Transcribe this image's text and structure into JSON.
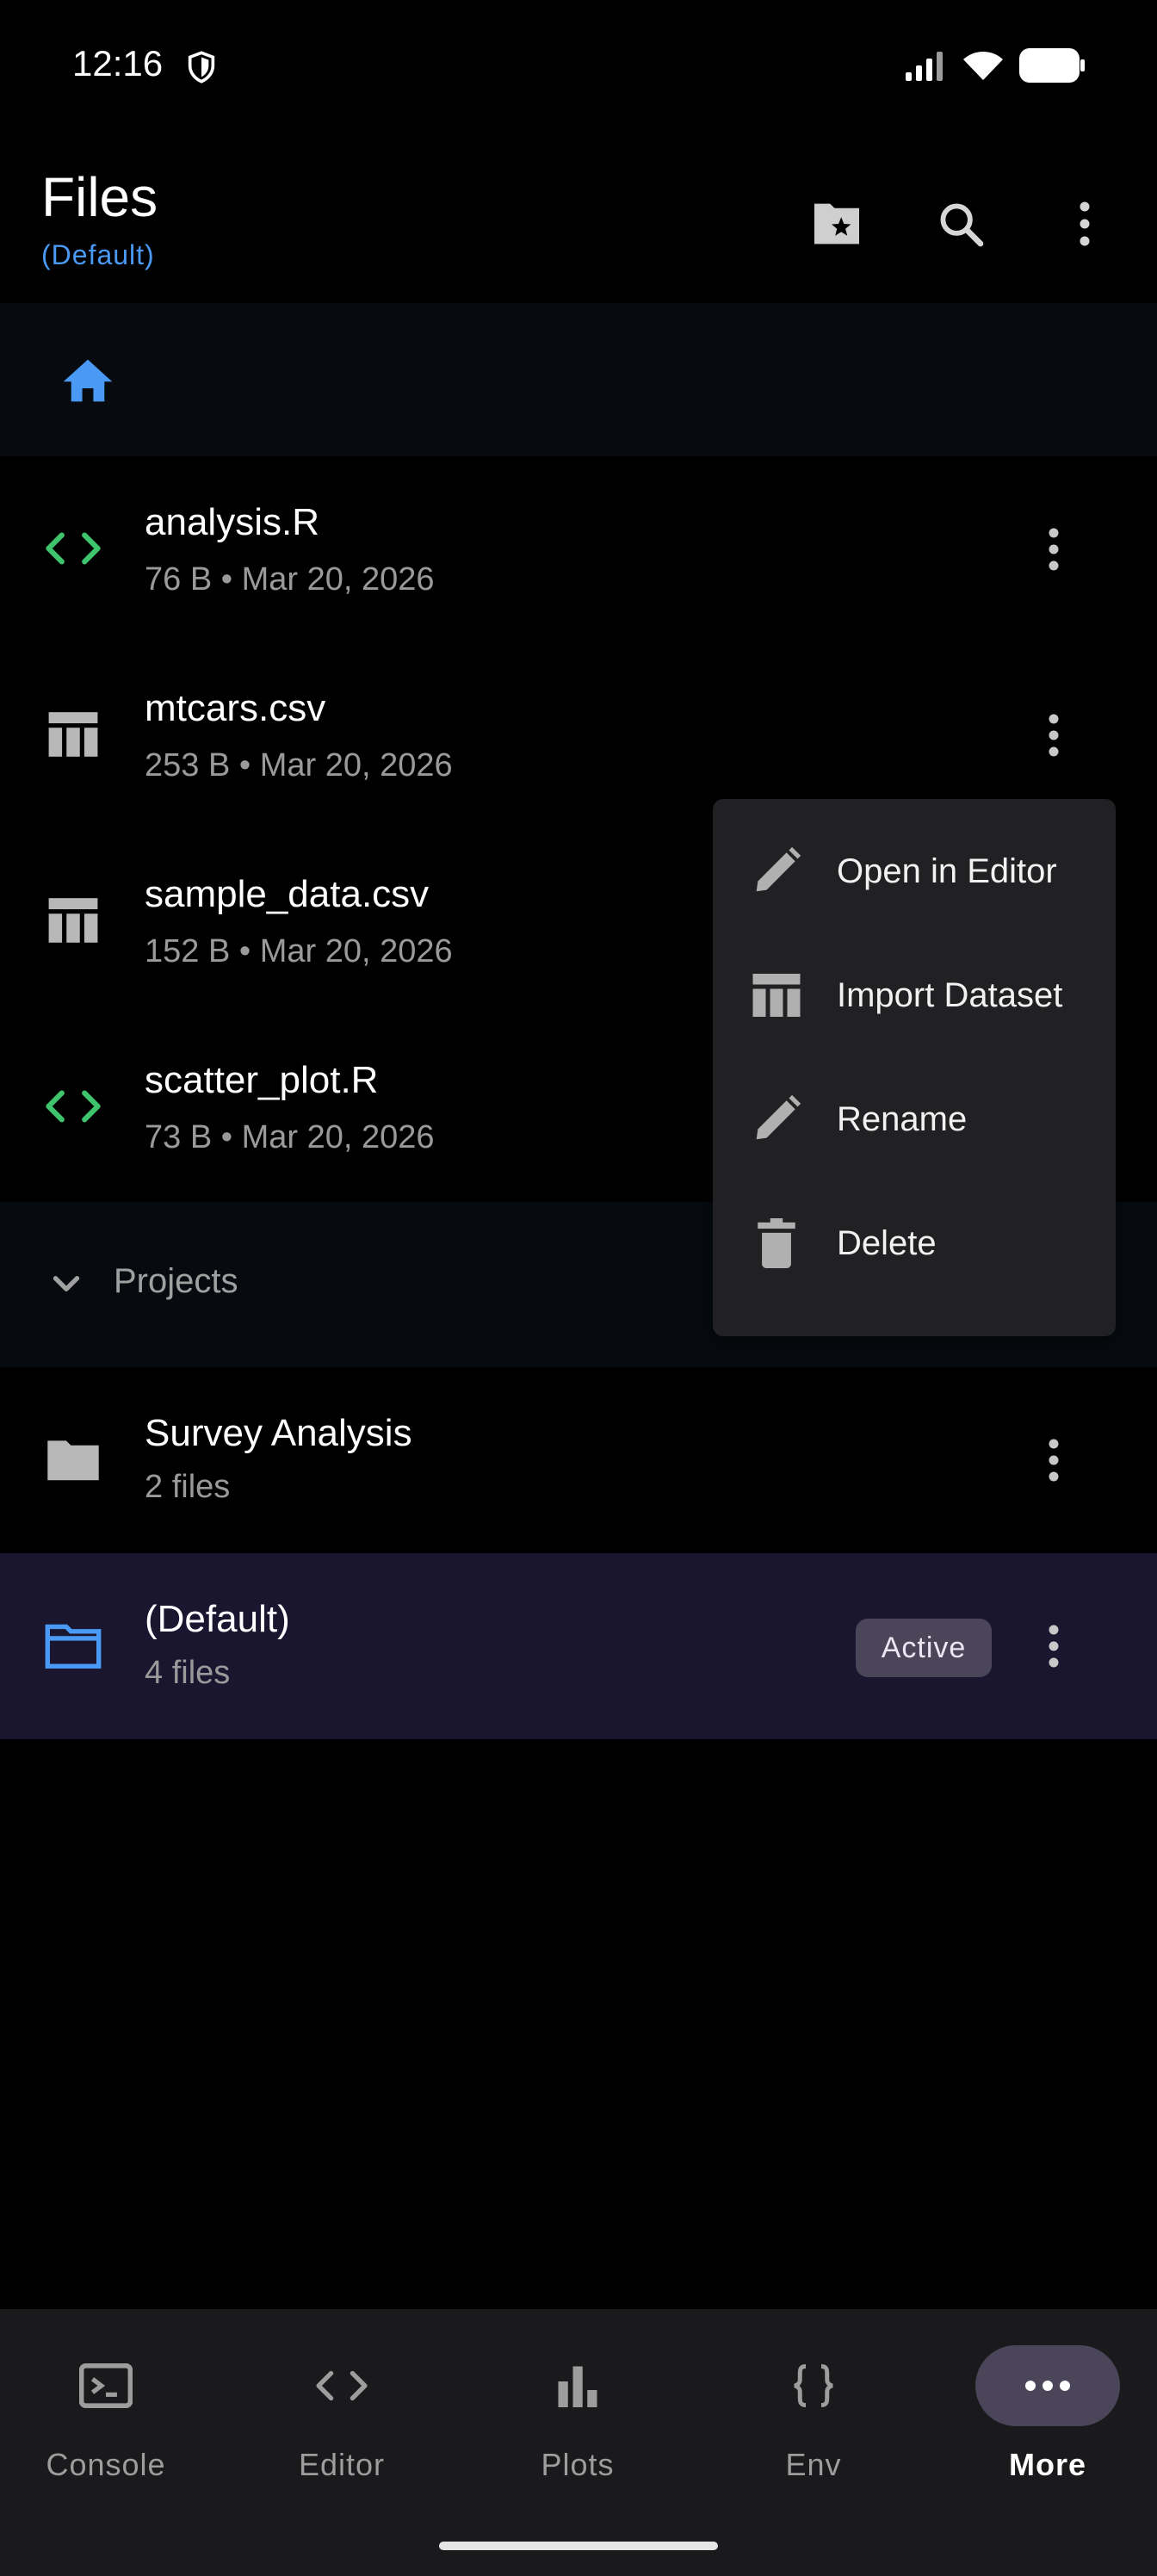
{
  "status_bar": {
    "time": "12:16"
  },
  "header": {
    "title": "Files",
    "subtitle": "(Default)"
  },
  "files": [
    {
      "name": "analysis.R",
      "meta": "76 B • Mar 20, 2026",
      "icon": "code-icon"
    },
    {
      "name": "mtcars.csv",
      "meta": "253 B • Mar 20, 2026",
      "icon": "table-icon"
    },
    {
      "name": "sample_data.csv",
      "meta": "152 B • Mar 20, 2026",
      "icon": "table-icon"
    },
    {
      "name": "scatter_plot.R",
      "meta": "73 B • Mar 20, 2026",
      "icon": "code-icon"
    }
  ],
  "projects": {
    "label": "Projects",
    "items": [
      {
        "name": "Survey Analysis",
        "meta": "2 files",
        "active": false
      },
      {
        "name": "(Default)",
        "meta": "4 files",
        "active": true,
        "badge": "Active"
      }
    ]
  },
  "context_menu": {
    "items": [
      {
        "label": "Open in Editor",
        "icon": "pencil-icon"
      },
      {
        "label": "Import Dataset",
        "icon": "table-icon"
      },
      {
        "label": "Rename",
        "icon": "pencil-icon"
      },
      {
        "label": "Delete",
        "icon": "trash-icon"
      }
    ]
  },
  "bottom_nav": {
    "items": [
      {
        "label": "Console",
        "icon": "console-icon"
      },
      {
        "label": "Editor",
        "icon": "code-icon"
      },
      {
        "label": "Plots",
        "icon": "bar-chart-icon"
      },
      {
        "label": "Env",
        "icon": "braces-icon"
      },
      {
        "label": "More",
        "icon": "more-horizontal-icon",
        "selected": true
      }
    ]
  },
  "colors": {
    "accent": "#4a9af5",
    "code_icon": "#3ec46d",
    "active_bg": "#1a1630",
    "badge_bg": "#4a4558"
  }
}
